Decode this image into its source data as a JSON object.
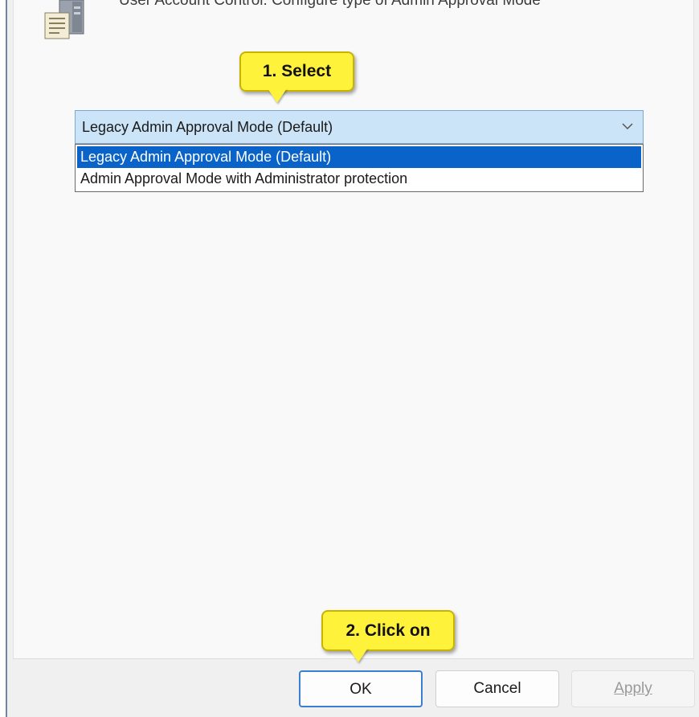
{
  "policy": {
    "title": "User Account Control: Configure type of Admin Approval Mode",
    "icon": "policy-document-icon"
  },
  "callouts": {
    "step1": "1. Select",
    "step2": "2. Click on"
  },
  "combo": {
    "selected_value": "Legacy Admin Approval Mode (Default)",
    "arrow_icon": "chevron-down-icon"
  },
  "dropdown": {
    "options": [
      "Legacy Admin Approval Mode (Default)",
      "Admin Approval Mode with Administrator protection"
    ],
    "selected_index": 0
  },
  "buttons": {
    "ok": "OK",
    "cancel": "Cancel",
    "apply": "Apply"
  },
  "colors": {
    "highlight": "#0a63c9",
    "callout": "#fff23a",
    "combo_bg": "#cce4f7"
  }
}
